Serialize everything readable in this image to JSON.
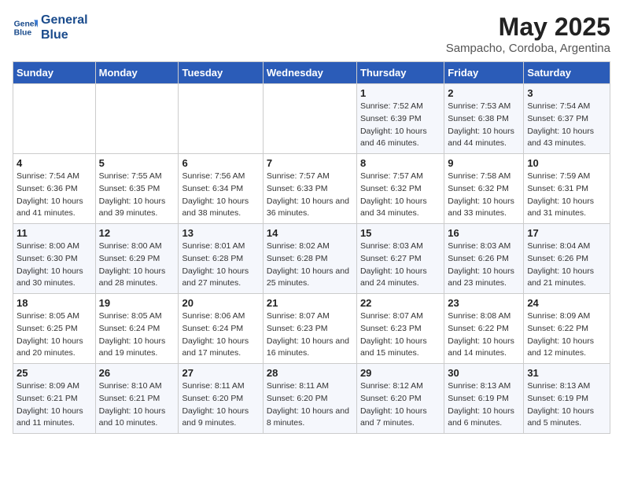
{
  "logo": {
    "line1": "General",
    "line2": "Blue"
  },
  "title": "May 2025",
  "subtitle": "Sampacho, Cordoba, Argentina",
  "days_of_week": [
    "Sunday",
    "Monday",
    "Tuesday",
    "Wednesday",
    "Thursday",
    "Friday",
    "Saturday"
  ],
  "weeks": [
    [
      {
        "day": "",
        "sunrise": "",
        "sunset": "",
        "daylight": ""
      },
      {
        "day": "",
        "sunrise": "",
        "sunset": "",
        "daylight": ""
      },
      {
        "day": "",
        "sunrise": "",
        "sunset": "",
        "daylight": ""
      },
      {
        "day": "",
        "sunrise": "",
        "sunset": "",
        "daylight": ""
      },
      {
        "day": "1",
        "sunrise": "7:52 AM",
        "sunset": "6:39 PM",
        "daylight": "10 hours and 46 minutes."
      },
      {
        "day": "2",
        "sunrise": "7:53 AM",
        "sunset": "6:38 PM",
        "daylight": "10 hours and 44 minutes."
      },
      {
        "day": "3",
        "sunrise": "7:54 AM",
        "sunset": "6:37 PM",
        "daylight": "10 hours and 43 minutes."
      }
    ],
    [
      {
        "day": "4",
        "sunrise": "7:54 AM",
        "sunset": "6:36 PM",
        "daylight": "10 hours and 41 minutes."
      },
      {
        "day": "5",
        "sunrise": "7:55 AM",
        "sunset": "6:35 PM",
        "daylight": "10 hours and 39 minutes."
      },
      {
        "day": "6",
        "sunrise": "7:56 AM",
        "sunset": "6:34 PM",
        "daylight": "10 hours and 38 minutes."
      },
      {
        "day": "7",
        "sunrise": "7:57 AM",
        "sunset": "6:33 PM",
        "daylight": "10 hours and 36 minutes."
      },
      {
        "day": "8",
        "sunrise": "7:57 AM",
        "sunset": "6:32 PM",
        "daylight": "10 hours and 34 minutes."
      },
      {
        "day": "9",
        "sunrise": "7:58 AM",
        "sunset": "6:32 PM",
        "daylight": "10 hours and 33 minutes."
      },
      {
        "day": "10",
        "sunrise": "7:59 AM",
        "sunset": "6:31 PM",
        "daylight": "10 hours and 31 minutes."
      }
    ],
    [
      {
        "day": "11",
        "sunrise": "8:00 AM",
        "sunset": "6:30 PM",
        "daylight": "10 hours and 30 minutes."
      },
      {
        "day": "12",
        "sunrise": "8:00 AM",
        "sunset": "6:29 PM",
        "daylight": "10 hours and 28 minutes."
      },
      {
        "day": "13",
        "sunrise": "8:01 AM",
        "sunset": "6:28 PM",
        "daylight": "10 hours and 27 minutes."
      },
      {
        "day": "14",
        "sunrise": "8:02 AM",
        "sunset": "6:28 PM",
        "daylight": "10 hours and 25 minutes."
      },
      {
        "day": "15",
        "sunrise": "8:03 AM",
        "sunset": "6:27 PM",
        "daylight": "10 hours and 24 minutes."
      },
      {
        "day": "16",
        "sunrise": "8:03 AM",
        "sunset": "6:26 PM",
        "daylight": "10 hours and 23 minutes."
      },
      {
        "day": "17",
        "sunrise": "8:04 AM",
        "sunset": "6:26 PM",
        "daylight": "10 hours and 21 minutes."
      }
    ],
    [
      {
        "day": "18",
        "sunrise": "8:05 AM",
        "sunset": "6:25 PM",
        "daylight": "10 hours and 20 minutes."
      },
      {
        "day": "19",
        "sunrise": "8:05 AM",
        "sunset": "6:24 PM",
        "daylight": "10 hours and 19 minutes."
      },
      {
        "day": "20",
        "sunrise": "8:06 AM",
        "sunset": "6:24 PM",
        "daylight": "10 hours and 17 minutes."
      },
      {
        "day": "21",
        "sunrise": "8:07 AM",
        "sunset": "6:23 PM",
        "daylight": "10 hours and 16 minutes."
      },
      {
        "day": "22",
        "sunrise": "8:07 AM",
        "sunset": "6:23 PM",
        "daylight": "10 hours and 15 minutes."
      },
      {
        "day": "23",
        "sunrise": "8:08 AM",
        "sunset": "6:22 PM",
        "daylight": "10 hours and 14 minutes."
      },
      {
        "day": "24",
        "sunrise": "8:09 AM",
        "sunset": "6:22 PM",
        "daylight": "10 hours and 12 minutes."
      }
    ],
    [
      {
        "day": "25",
        "sunrise": "8:09 AM",
        "sunset": "6:21 PM",
        "daylight": "10 hours and 11 minutes."
      },
      {
        "day": "26",
        "sunrise": "8:10 AM",
        "sunset": "6:21 PM",
        "daylight": "10 hours and 10 minutes."
      },
      {
        "day": "27",
        "sunrise": "8:11 AM",
        "sunset": "6:20 PM",
        "daylight": "10 hours and 9 minutes."
      },
      {
        "day": "28",
        "sunrise": "8:11 AM",
        "sunset": "6:20 PM",
        "daylight": "10 hours and 8 minutes."
      },
      {
        "day": "29",
        "sunrise": "8:12 AM",
        "sunset": "6:20 PM",
        "daylight": "10 hours and 7 minutes."
      },
      {
        "day": "30",
        "sunrise": "8:13 AM",
        "sunset": "6:19 PM",
        "daylight": "10 hours and 6 minutes."
      },
      {
        "day": "31",
        "sunrise": "8:13 AM",
        "sunset": "6:19 PM",
        "daylight": "10 hours and 5 minutes."
      }
    ]
  ]
}
